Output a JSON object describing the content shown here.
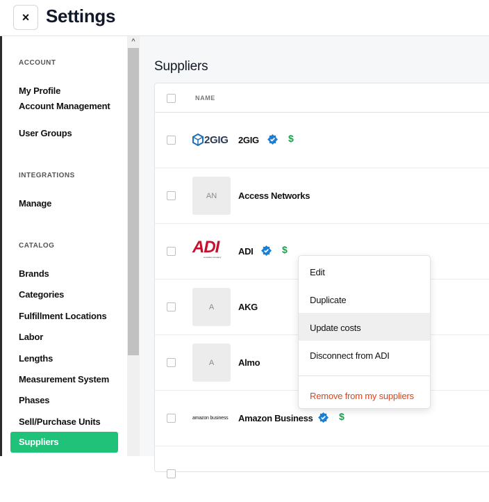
{
  "header": {
    "close_icon": "×",
    "title": "Settings"
  },
  "sidebar": {
    "sections": [
      {
        "title": "ACCOUNT",
        "items": [
          "My Profile",
          "Account Management",
          "User Groups"
        ]
      },
      {
        "title": "INTEGRATIONS",
        "items": [
          "Manage"
        ]
      },
      {
        "title": "CATALOG",
        "items": [
          "Brands",
          "Categories",
          "Fulfillment Locations",
          "Labor",
          "Lengths",
          "Measurement System",
          "Phases",
          "Sell/Purchase Units",
          "Suppliers"
        ]
      }
    ],
    "active_item": "Suppliers",
    "accent_color": "#20c27a"
  },
  "scrollbar": {
    "up_icon": "^"
  },
  "main": {
    "title": "Suppliers",
    "table": {
      "column_name": "NAME",
      "rows": [
        {
          "logo_text": "2GIG",
          "name": "2GIG",
          "verified": true,
          "priced": true
        },
        {
          "logo_text": "AN",
          "name": "Access Networks",
          "verified": false,
          "priced": false
        },
        {
          "logo_text": "ADI",
          "logo_subtext": "a resideo company",
          "name": "ADI",
          "verified": true,
          "priced": true
        },
        {
          "logo_text": "A",
          "name": "AKG",
          "verified": false,
          "priced": false
        },
        {
          "logo_text": "A",
          "name": "Almo",
          "verified": false,
          "priced": false
        },
        {
          "logo_text": "amazon business",
          "name": "Amazon Business",
          "verified": true,
          "priced": true
        }
      ],
      "price_symbol": "$"
    }
  },
  "context_menu": {
    "items": [
      "Edit",
      "Duplicate",
      "Update costs",
      "Disconnect from ADI"
    ],
    "danger_item": "Remove from my suppliers",
    "hovered": "Update costs",
    "danger_color": "#d9461e"
  },
  "colors": {
    "verified": "#1d7fd4",
    "price": "#16a34a"
  }
}
